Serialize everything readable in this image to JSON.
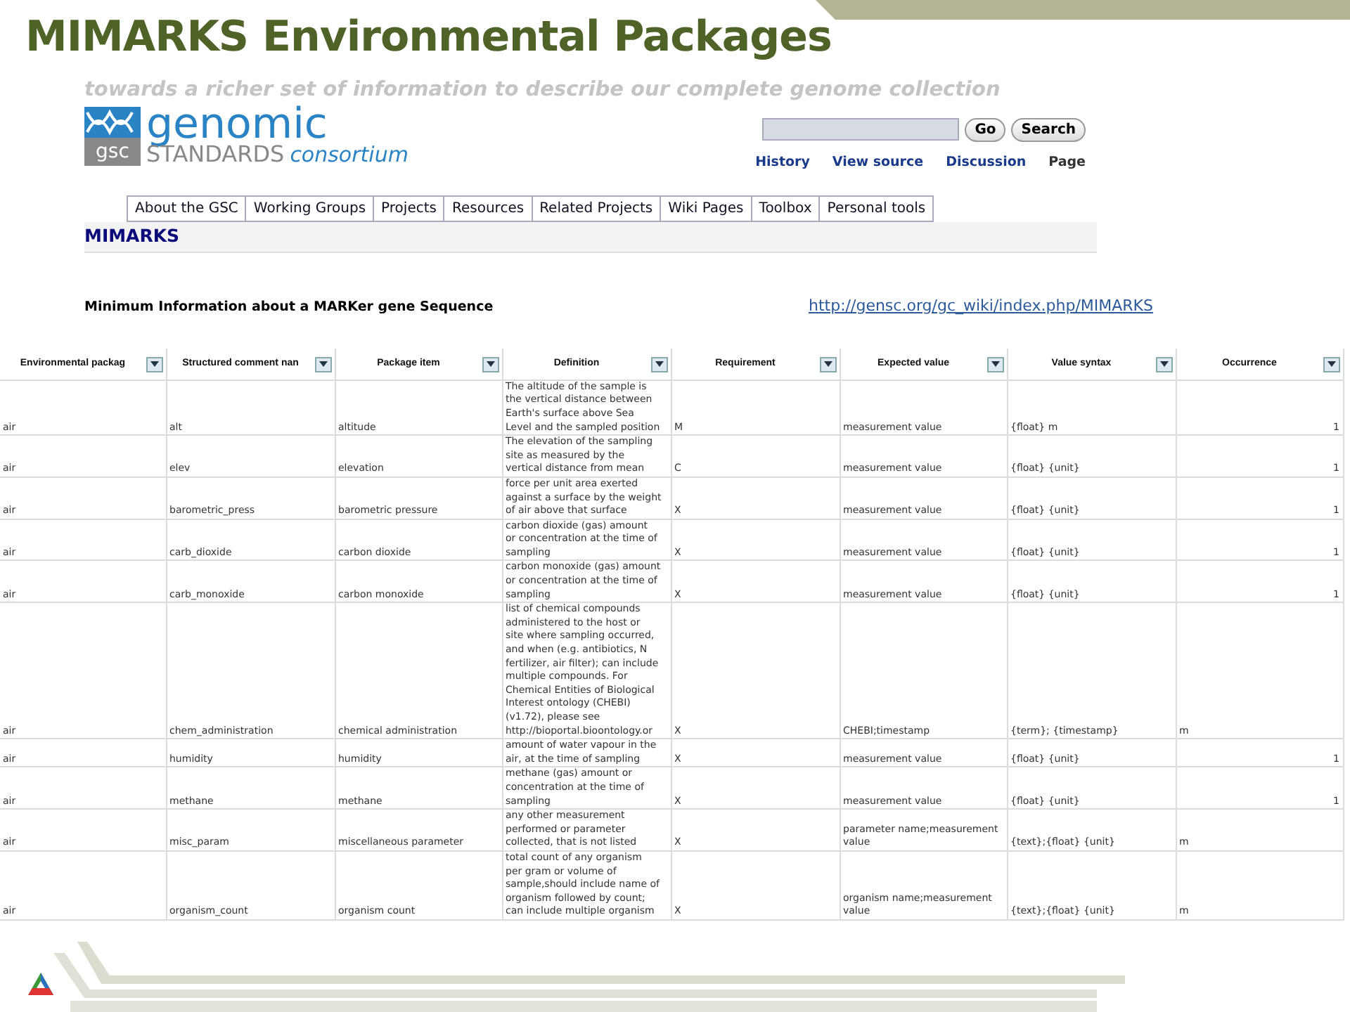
{
  "slide": {
    "title": "MIMARKS Environmental Packages"
  },
  "wiki": {
    "tagline": "towards a richer set of information to describe our complete genome collection",
    "logo": {
      "badge": "gsc",
      "word": "genomic",
      "line_a": "STANDARDS",
      "line_b": "consortium"
    },
    "buttons": [
      "Go",
      "Search"
    ],
    "page_links": [
      {
        "label": "History",
        "selected": false
      },
      {
        "label": "View source",
        "selected": false
      },
      {
        "label": "Discussion",
        "selected": false
      },
      {
        "label": "Page",
        "selected": true
      }
    ],
    "tabs": [
      "About the GSC",
      "Working Groups",
      "Projects",
      "Resources",
      "Related Projects",
      "Wiki Pages",
      "Toolbox",
      "Personal tools"
    ],
    "page_title": "MIMARKS",
    "subtitle": "Minimum Information about a MARKer gene Sequence"
  },
  "url_link": "http://gensc.org/gc_wiki/index.php/MIMARKS",
  "table": {
    "columns": [
      "Environmental packag",
      "Structured comment nan",
      "Package item",
      "Definition",
      "Requirement",
      "Expected value",
      "Value syntax",
      "Occurrence"
    ],
    "rows": [
      [
        "air",
        "alt",
        "altitude",
        "The altitude of the sample is\nthe vertical distance between\nEarth's surface above Sea\nLevel and the sampled position",
        "M",
        "measurement value",
        "{float} m",
        "1"
      ],
      [
        "air",
        "elev",
        "elevation",
        "The elevation of the sampling\nsite as measured by the\nvertical distance from mean",
        "C",
        "measurement value",
        "{float} {unit}",
        "1"
      ],
      [
        "air",
        "barometric_press",
        "barometric pressure",
        "force per unit area exerted\nagainst a surface by the weight\nof air above that surface",
        "X",
        "measurement value",
        "{float} {unit}",
        "1"
      ],
      [
        "air",
        "carb_dioxide",
        "carbon dioxide",
        "carbon dioxide (gas) amount\nor concentration at the time of\nsampling",
        "X",
        "measurement value",
        "{float} {unit}",
        "1"
      ],
      [
        "air",
        "carb_monoxide",
        "carbon monoxide",
        "carbon monoxide (gas) amount\nor concentration at the time of\nsampling",
        "X",
        "measurement value",
        "{float} {unit}",
        "1"
      ],
      [
        "air",
        "chem_administration",
        "chemical administration",
        "list of chemical compounds\nadministered to the host or\nsite where sampling occurred,\nand when (e.g. antibiotics, N\nfertilizer, air filter); can include\nmultiple compounds. For\nChemical Entities of Biological\nInterest ontology (CHEBI)\n(v1.72), please see\nhttp://bioportal.bioontology.or",
        "X",
        "CHEBI;timestamp",
        "{term}; {timestamp}",
        "m"
      ],
      [
        "air",
        "humidity",
        "humidity",
        "amount of water vapour in the\nair, at the time of sampling",
        "X",
        "measurement value",
        "{float} {unit}",
        "1"
      ],
      [
        "air",
        "methane",
        "methane",
        "methane (gas) amount or\nconcentration at the time of\nsampling",
        "X",
        "measurement value",
        "{float} {unit}",
        "1"
      ],
      [
        "air",
        "misc_param",
        "miscellaneous parameter",
        "any other measurement\nperformed or parameter\ncollected, that is not listed",
        "X",
        "parameter name;measurement\nvalue",
        "{text};{float} {unit}",
        "m"
      ],
      [
        "air",
        "organism_count",
        "organism count",
        "total count of any organism\nper gram or volume of\nsample,should include name of\norganism followed by count;\ncan include multiple organism",
        "X",
        "organism name;measurement\nvalue",
        "{text};{float} {unit}",
        "m"
      ]
    ]
  }
}
